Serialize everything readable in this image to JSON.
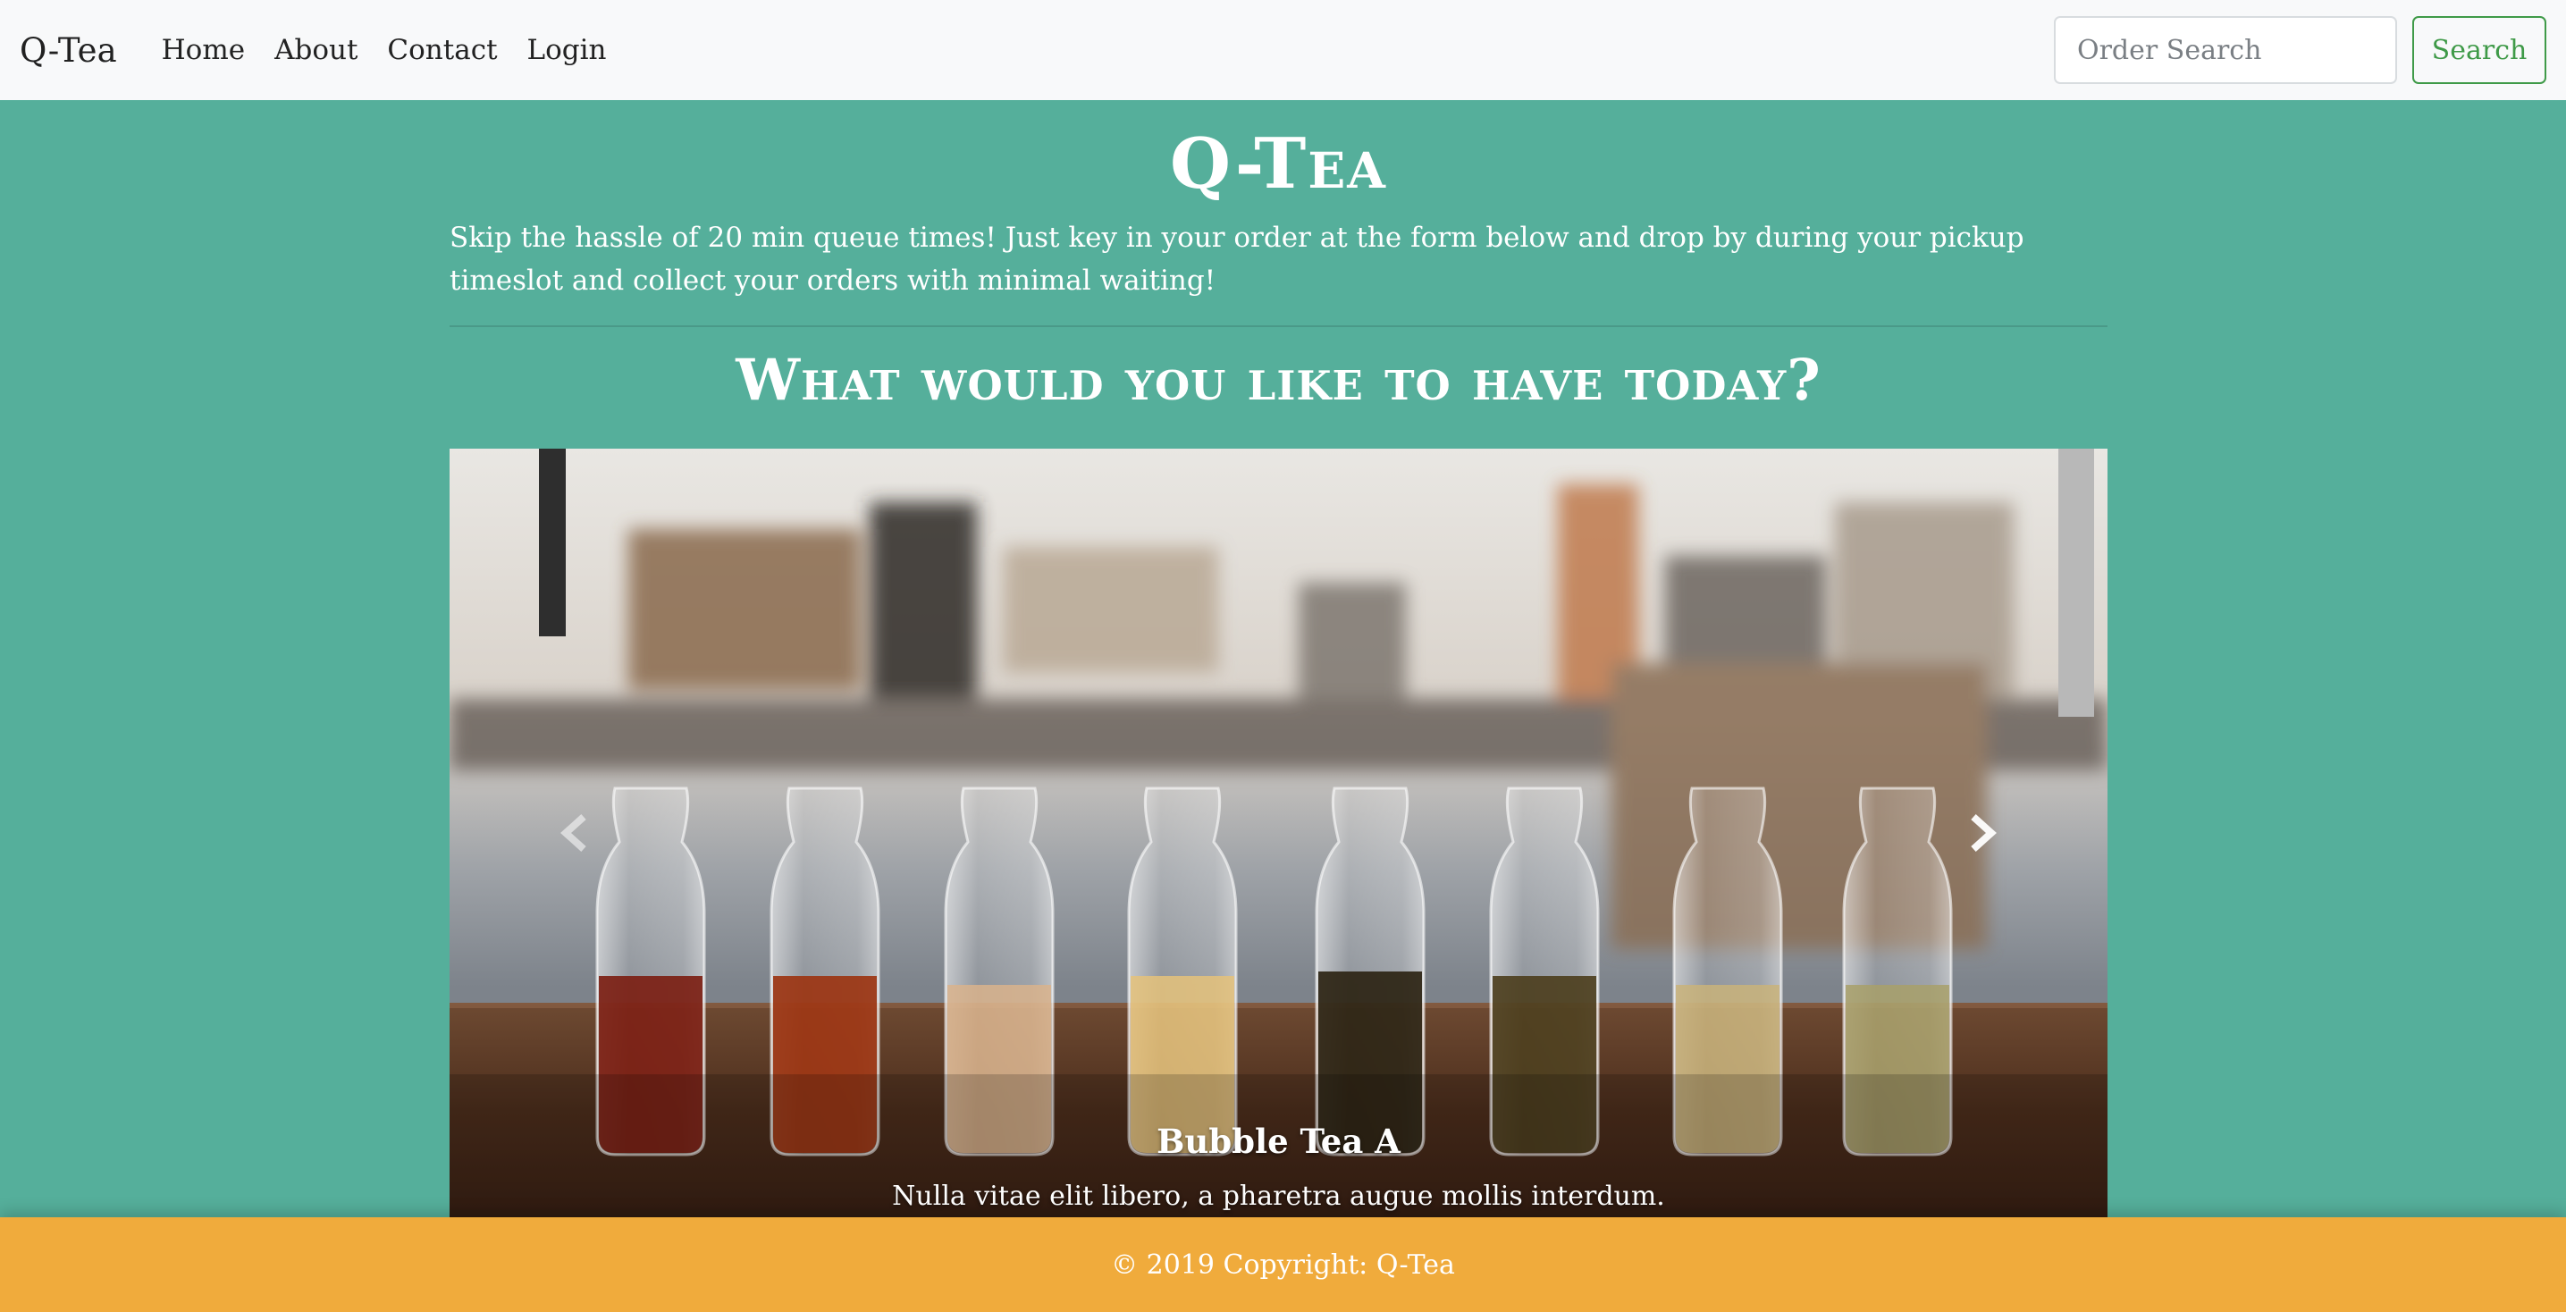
{
  "navbar": {
    "brand": "Q-Tea",
    "links": [
      "Home",
      "About",
      "Contact",
      "Login"
    ],
    "search_placeholder": "Order Search",
    "search_button": "Search"
  },
  "hero": {
    "title": "Q-Tea",
    "description": "Skip the hassle of 20 min queue times! Just key in your order at the form below and drop by during your pickup timeslot and collect your orders with minimal waiting!"
  },
  "section": {
    "title": "What would you like to have today?"
  },
  "carousel": {
    "slide_title": "Bubble Tea A",
    "slide_text": "Nulla vitae elit libero, a pharetra augue mollis interdum.",
    "prev_icon": "chevron-left-icon",
    "next_icon": "chevron-right-icon"
  },
  "footer": {
    "copyright": "© 2019 Copyright: Q-Tea"
  },
  "colors": {
    "page_background": "#55af9b",
    "navbar_background": "#f8f9fa",
    "search_button": "#3f9a48",
    "footer_background": "#f0ab3c"
  }
}
